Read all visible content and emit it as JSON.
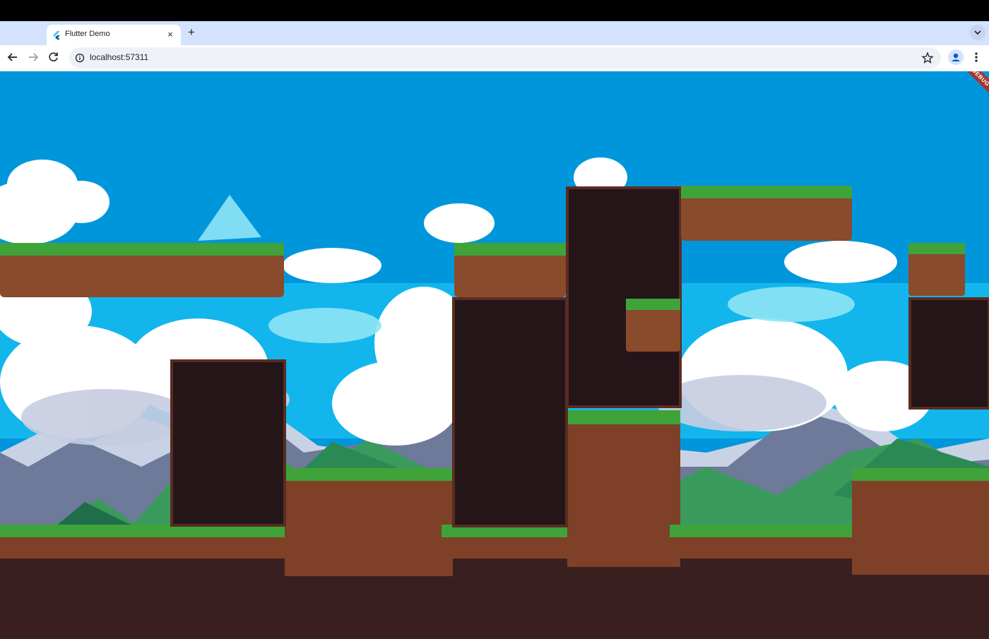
{
  "browser": {
    "tab_title": "Flutter Demo",
    "url": "localhost:57311",
    "new_tab_symbol": "+",
    "close_symbol": "×"
  },
  "app": {
    "debug_banner": "DEBUG"
  },
  "icons": {
    "tab_favicon": "flutter-logo-icon",
    "back": "back-arrow-icon",
    "forward": "forward-arrow-icon",
    "reload": "reload-icon",
    "site_info": "site-info-icon",
    "bookmark": "bookmark-star-icon",
    "profile": "profile-avatar-icon",
    "menu": "kebab-menu-icon",
    "tab_list": "chevron-down-icon"
  },
  "colors": {
    "sky": "#0096dc",
    "grass": "#3fa33a",
    "dirt": "#8a4a2c",
    "dark_dirt": "#3a1f20",
    "debug_banner": "#a5362e"
  }
}
